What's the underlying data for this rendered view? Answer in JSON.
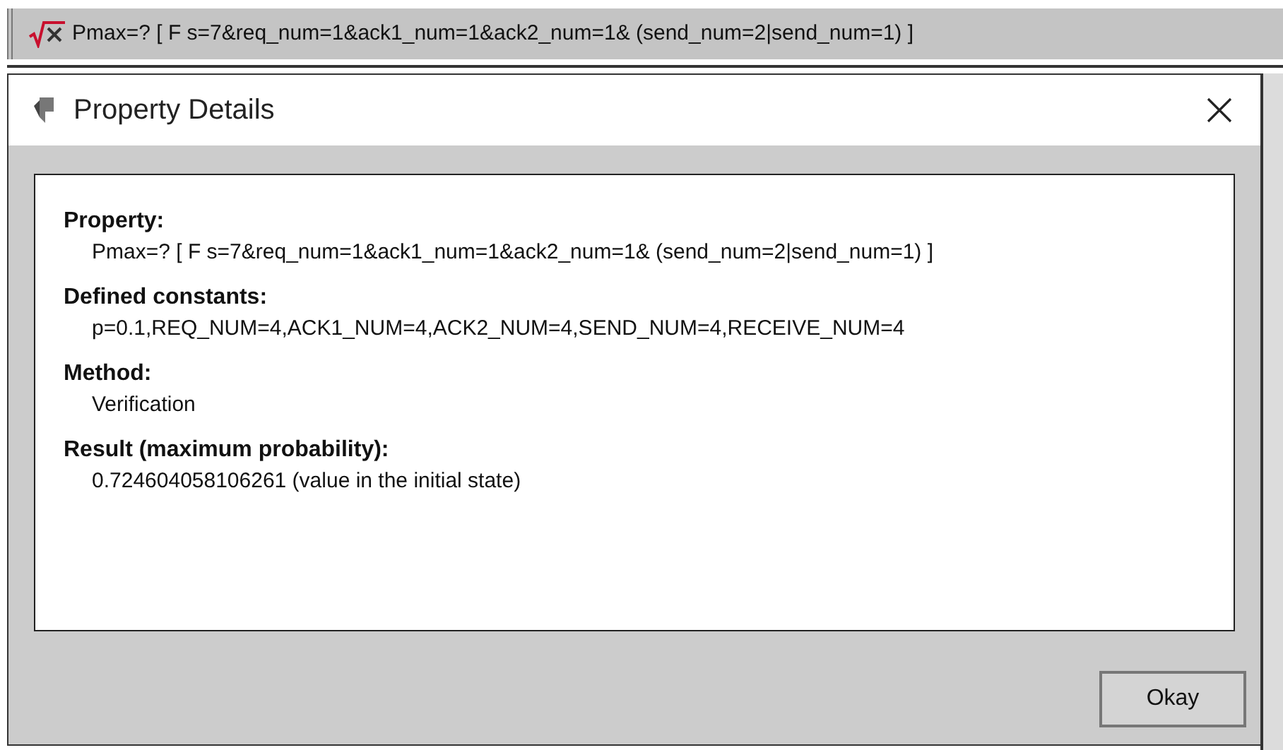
{
  "property_bar": {
    "text": "Pmax=? [ F s=7&req_num=1&ack1_num=1&ack2_num=1& (send_num=2|send_num=1) ]"
  },
  "dialog": {
    "title": "Property Details",
    "sections": [
      {
        "heading": "Property:",
        "value": "Pmax=? [ F s=7&req_num=1&ack1_num=1&ack2_num=1& (send_num=2|send_num=1) ]"
      },
      {
        "heading": "Defined constants:",
        "value": "p=0.1,REQ_NUM=4,ACK1_NUM=4,ACK2_NUM=4,SEND_NUM=4,RECEIVE_NUM=4"
      },
      {
        "heading": "Method:",
        "value": "Verification"
      },
      {
        "heading": "Result (maximum probability):",
        "value": "0.724604058106261 (value in the initial state)"
      }
    ],
    "button": "Okay"
  }
}
